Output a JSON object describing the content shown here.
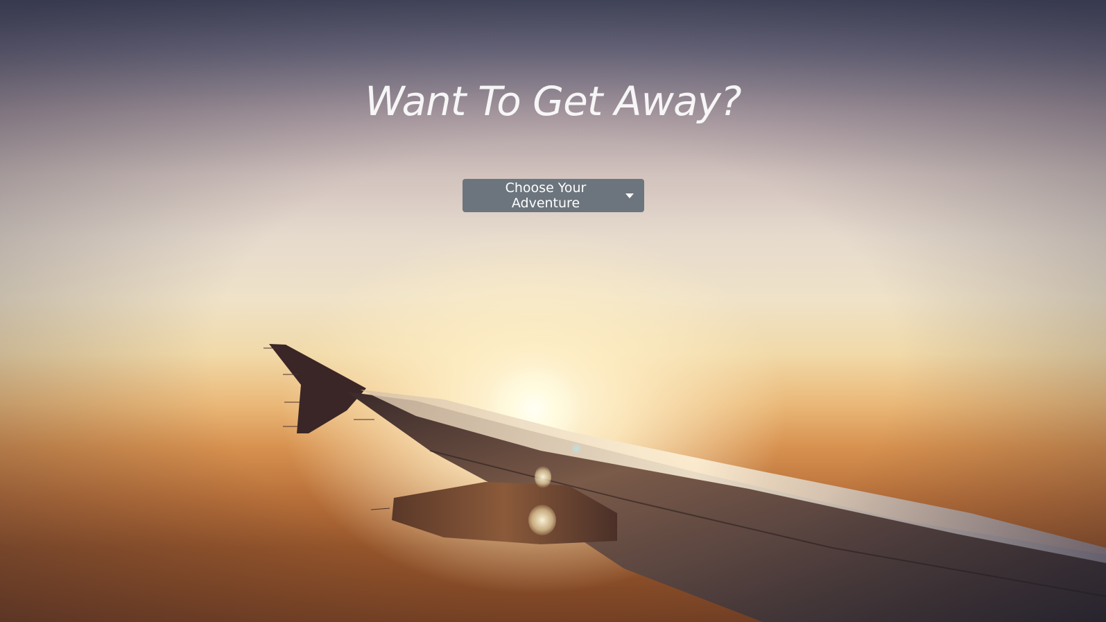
{
  "hero": {
    "headline": "Want To Get Away?",
    "background_image": "airplane-wing-sunset"
  },
  "dropdown": {
    "label": "Choose Your Adventure",
    "icon": "caret-down-icon",
    "background_color": "#6c757d",
    "text_color": "#ffffff"
  }
}
